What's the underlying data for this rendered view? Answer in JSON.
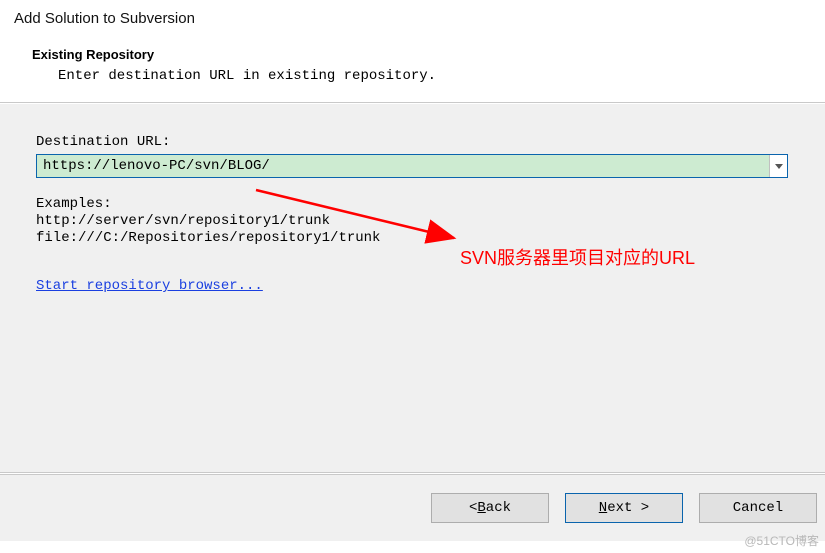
{
  "header": {
    "title": "Add Solution to Subversion",
    "section_heading": "Existing Repository",
    "section_desc": "Enter destination URL in existing repository."
  },
  "content": {
    "url_label": "Destination URL:",
    "url_value": "https://lenovo-PC/svn/BLOG/",
    "examples_label": "Examples:",
    "example1": "http://server/svn/repository1/trunk",
    "example2": "file:///C:/Repositories/repository1/trunk",
    "link_text": "Start repository browser..."
  },
  "annotation": {
    "text": "SVN服务器里项目对应的URL"
  },
  "footer": {
    "back_prefix": "< ",
    "back_letter": "B",
    "back_rest": "ack",
    "next_letter": "N",
    "next_rest": "ext >",
    "cancel": "Cancel"
  },
  "watermark": "@51CTO博客"
}
